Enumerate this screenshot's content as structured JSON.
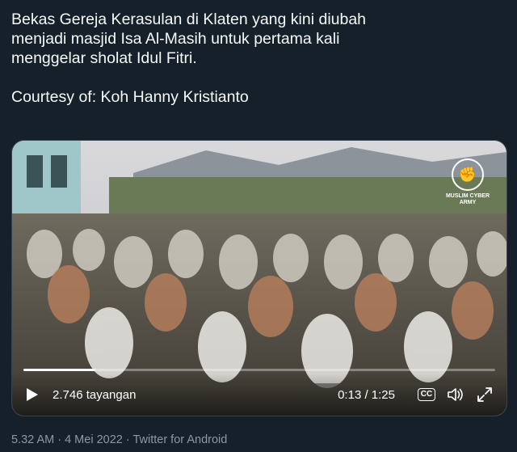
{
  "tweet": {
    "lines": [
      "Bekas Gereja Kerasulan di Klaten yang kini diubah",
      "menjadi masjid Isa Al-Masih untuk pertama kali",
      "menggelar sholat Idul Fitri."
    ],
    "courtesy": "Courtesy of: Koh Hanny Kristianto"
  },
  "video": {
    "watermark": "MUSLIM CYBER ARMY",
    "views": "2.746 tayangan",
    "time": "0:13 / 1:25",
    "cc_label": "CC",
    "progress": 0.153,
    "icons": [
      "play-icon",
      "captions-icon",
      "volume-icon",
      "fullscreen-icon"
    ]
  },
  "meta": {
    "line": "5.32 AM · 4 Mei 2022 · Twitter for Android"
  },
  "colors": {
    "background": "#15202b",
    "text": "#f7f9f9",
    "secondary": "#8b98a5",
    "border": "#38444d"
  }
}
